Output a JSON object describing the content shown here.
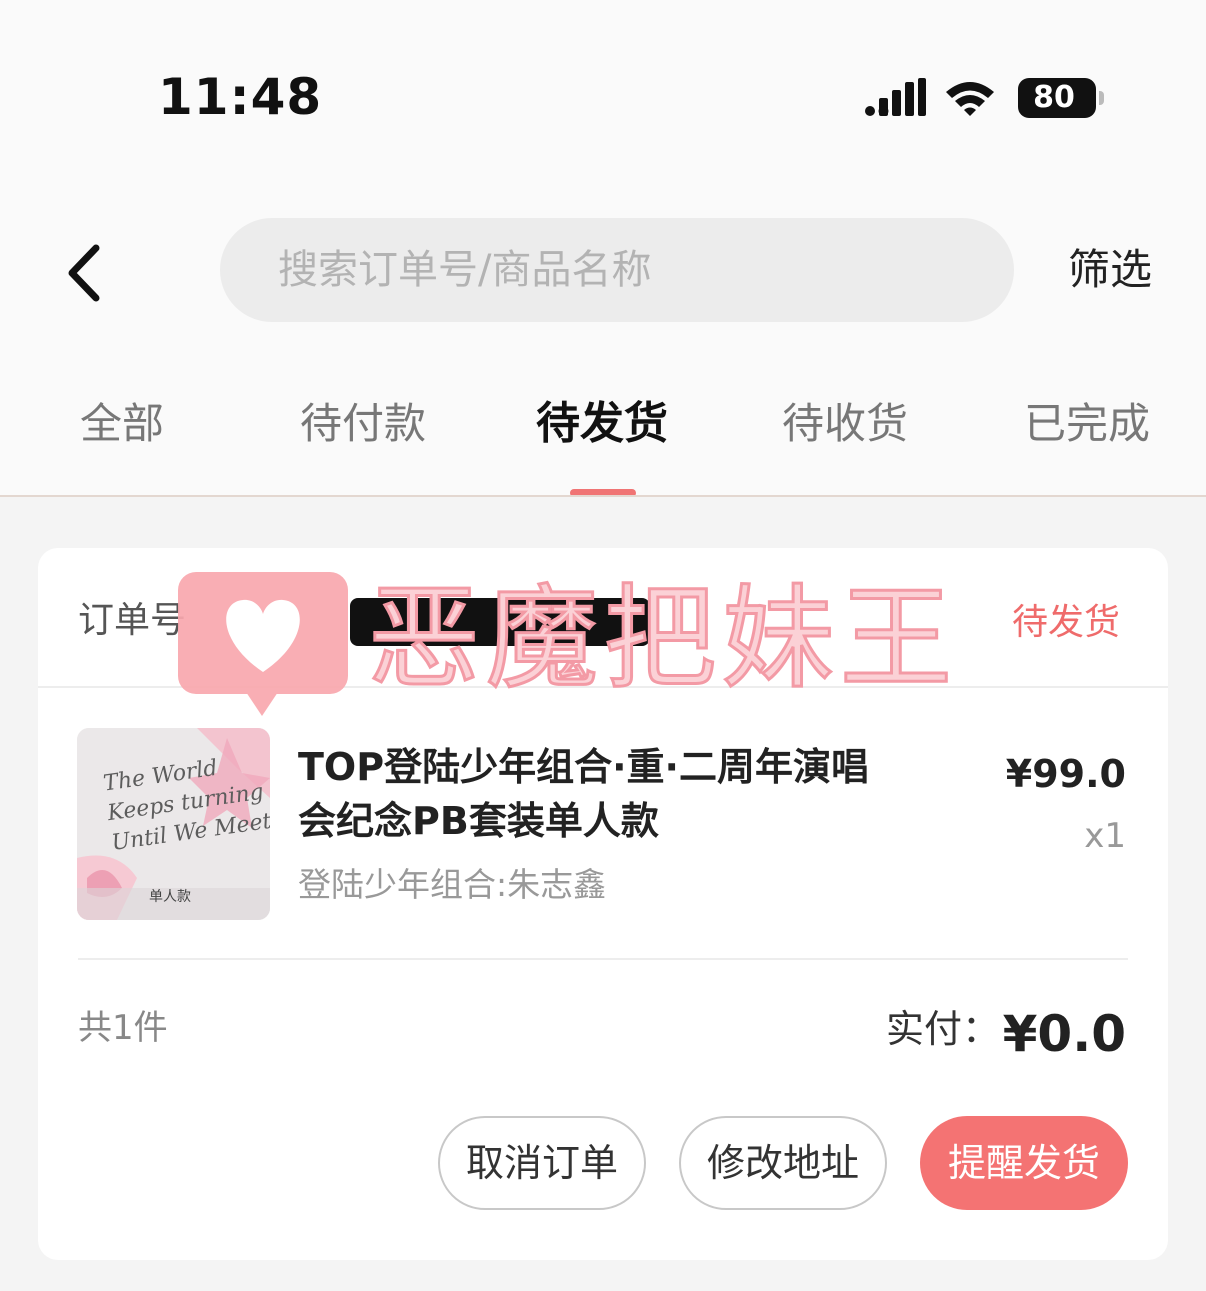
{
  "status_bar": {
    "time": "11:48",
    "battery": "80"
  },
  "header": {
    "search_placeholder": "搜索订单号/商品名称",
    "filter_label": "筛选"
  },
  "tabs": [
    {
      "label": "全部"
    },
    {
      "label": "待付款"
    },
    {
      "label": "待发货",
      "active": true
    },
    {
      "label": "待收货"
    },
    {
      "label": "已完成"
    }
  ],
  "order": {
    "order_no_label": "订单号",
    "status": "待发货",
    "item": {
      "title": "TOP登陆少年组合·重·二周年演唱会纪念PB套装单人款",
      "variant": "登陆少年组合:朱志鑫",
      "price": "¥99.0",
      "quantity": "x1",
      "image_text": "The World Keeps turning Until We Meet",
      "image_caption": "单人款"
    },
    "count_text": "共1件",
    "paid_label": "实付：",
    "paid_value": "¥0.0",
    "buttons": {
      "cancel": "取消订单",
      "modify_address": "修改地址",
      "remind": "提醒发货"
    }
  },
  "watermark": {
    "text": "恶魔把妹王"
  },
  "colors": {
    "accent": "#f47373",
    "status_red": "#ef6b6b",
    "background": "#f4f4f4"
  }
}
